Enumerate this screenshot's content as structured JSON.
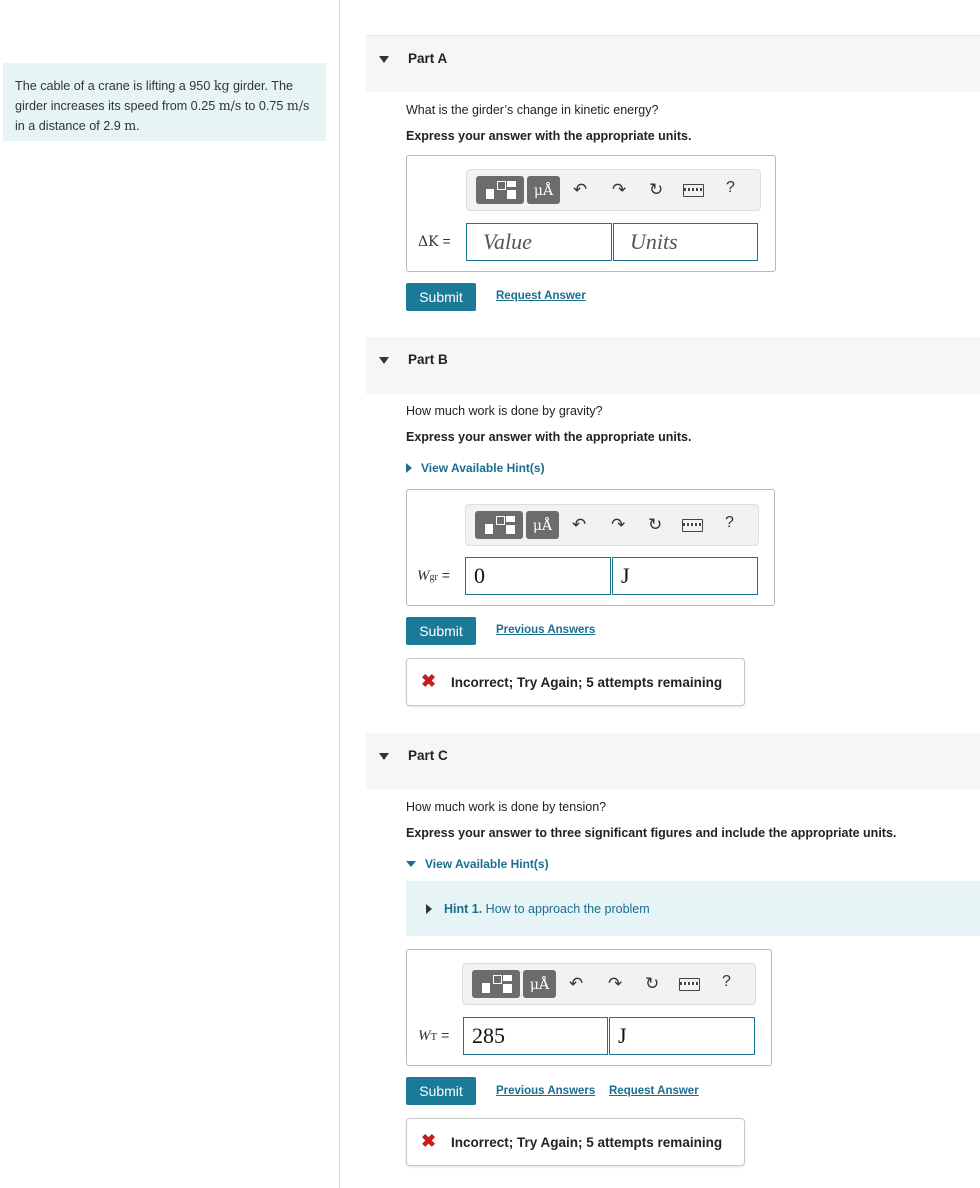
{
  "problem": {
    "text_1": "The cable of a crane is lifting a 950 ",
    "text_1_unit": "kg",
    "text_2": " girder. The girder increases its speed from 0.25 ",
    "unit_ms_1": "m/s",
    "text_3": " to 0.75 ",
    "unit_ms_2": "m/s",
    "text_4": " in a distance of 2.9 ",
    "unit_m": "m",
    "text_5": "."
  },
  "parts": {
    "a": {
      "title": "Part A",
      "question": "What is the girder’s change in kinetic energy?",
      "instruction": "Express your answer with the appropriate units.",
      "label": "ΔK",
      "eq": "=",
      "value_placeholder": "Value",
      "units_placeholder": "Units",
      "submit": "Submit",
      "request_answer": "Request Answer"
    },
    "b": {
      "title": "Part B",
      "question": "How much work is done by gravity?",
      "instruction": "Express your answer with the appropriate units.",
      "hint_toggle": "View Available Hint(s)",
      "label_main": "W",
      "label_sub": "gr",
      "eq": "=",
      "value": "0",
      "units": "J",
      "submit": "Submit",
      "previous_answers": "Previous Answers",
      "feedback": "Incorrect; Try Again; 5 attempts remaining"
    },
    "c": {
      "title": "Part C",
      "question": "How much work is done by tension?",
      "instruction": "Express your answer to three significant figures and include the appropriate units.",
      "hint_toggle": "View Available Hint(s)",
      "hint_number": "Hint 1.",
      "hint_text": " How to approach the problem",
      "label_main": "W",
      "label_sub": "T",
      "eq": "=",
      "value": "285",
      "units": "J",
      "submit": "Submit",
      "previous_answers": "Previous Answers",
      "request_answer": "Request Answer",
      "feedback": "Incorrect; Try Again; 5 attempts remaining"
    }
  },
  "toolbar": {
    "units_button": "μÅ",
    "help": "?"
  },
  "icons": {
    "feedback_icon": "x-mark",
    "undo": "undo-arrow",
    "redo": "redo-arrow",
    "reset": "reset-arrow",
    "keyboard": "keyboard",
    "template": "template-blocks"
  },
  "colors": {
    "accent": "#1a7a98",
    "link": "#1a6e8e",
    "error": "#cc1b1b",
    "panel_bg": "#e6f4f6"
  }
}
